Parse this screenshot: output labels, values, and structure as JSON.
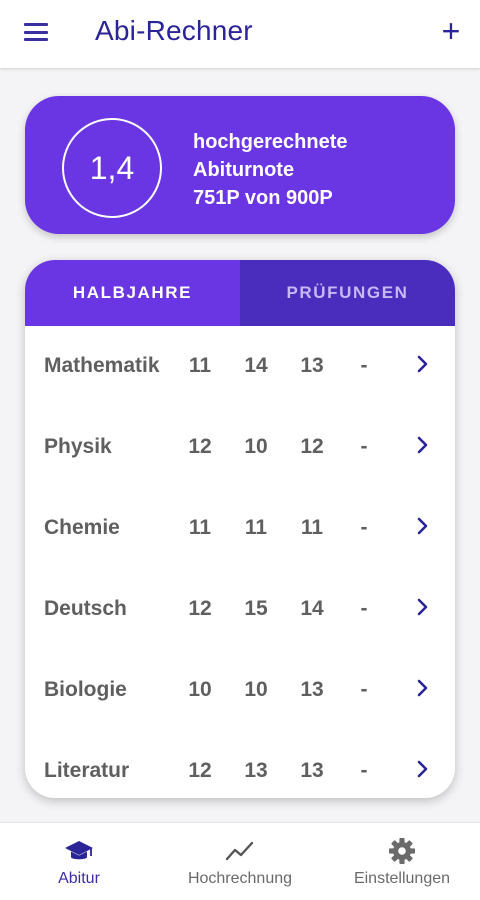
{
  "appbar": {
    "title": "Abi-Rechner",
    "menu_icon": "menu-icon",
    "add_icon": "plus-icon"
  },
  "score": {
    "grade": "1,4",
    "line1": "hochgerechnete",
    "line2": "Abiturnote",
    "line3": "751P von 900P"
  },
  "tabs": {
    "halbjahre": "HALBJAHRE",
    "pruefungen": "PRÜFUNGEN"
  },
  "subjects": [
    {
      "name": "Mathematik",
      "g1": "11",
      "g2": "14",
      "g3": "13",
      "g4": "-"
    },
    {
      "name": "Physik",
      "g1": "12",
      "g2": "10",
      "g3": "12",
      "g4": "-"
    },
    {
      "name": "Chemie",
      "g1": "11",
      "g2": "11",
      "g3": "11",
      "g4": "-"
    },
    {
      "name": "Deutsch",
      "g1": "12",
      "g2": "15",
      "g3": "14",
      "g4": "-"
    },
    {
      "name": "Biologie",
      "g1": "10",
      "g2": "10",
      "g3": "13",
      "g4": "-"
    },
    {
      "name": "Literatur",
      "g1": "12",
      "g2": "13",
      "g3": "13",
      "g4": "-"
    }
  ],
  "bottom_nav": [
    {
      "label": "Abitur",
      "icon": "graduation-cap-icon",
      "active": true
    },
    {
      "label": "Hochrechnung",
      "icon": "trend-line-icon",
      "active": false
    },
    {
      "label": "Einstellungen",
      "icon": "gear-icon",
      "active": false
    }
  ],
  "colors": {
    "primary": "#6a35e2",
    "primary_dark": "#4a2dbd",
    "title": "#2b2496",
    "text_gray": "#5f5f5f"
  }
}
